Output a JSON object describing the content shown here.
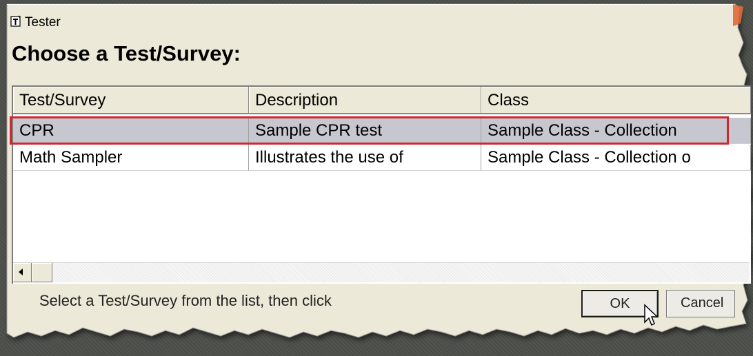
{
  "window": {
    "title": "Tester",
    "icon": "tester-app-icon"
  },
  "heading": "Choose a Test/Survey:",
  "table": {
    "columns": [
      "Test/Survey",
      "Description",
      "Class"
    ],
    "rows": [
      [
        "CPR",
        "Sample CPR test",
        "Sample Class - Collection"
      ],
      [
        "Math Sampler",
        "Illustrates the use of",
        "Sample Class - Collection o"
      ]
    ],
    "selected_row": 0
  },
  "status_text": "Select a Test/Survey from the list, then click",
  "buttons": {
    "ok": "OK",
    "cancel": "Cancel"
  },
  "colors": {
    "highlight_border": "#d3252c",
    "selected_row_bg": "#c7c7cf",
    "dialog_bg": "#ece9d8",
    "outer_bg": "#4d4f4a"
  }
}
